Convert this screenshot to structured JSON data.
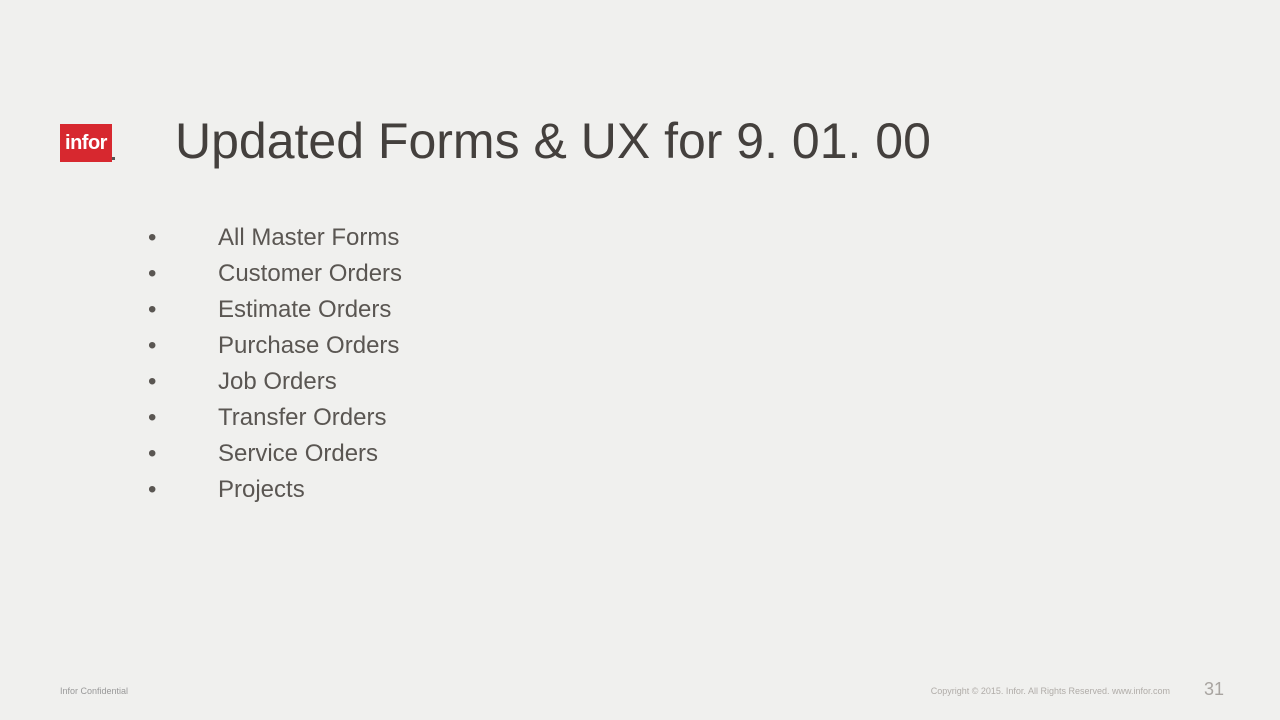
{
  "logo": {
    "text": "infor"
  },
  "title": "Updated Forms & UX  for 9. 01. 00",
  "bullets": [
    "All Master Forms",
    "Customer Orders",
    "Estimate Orders",
    "Purchase Orders",
    "Job Orders",
    "Transfer Orders",
    "Service Orders",
    "Projects"
  ],
  "footer": {
    "left": "Infor Confidential",
    "right": "Copyright © 2015. Infor. All Rights Reserved. www.infor.com",
    "page": "31"
  }
}
